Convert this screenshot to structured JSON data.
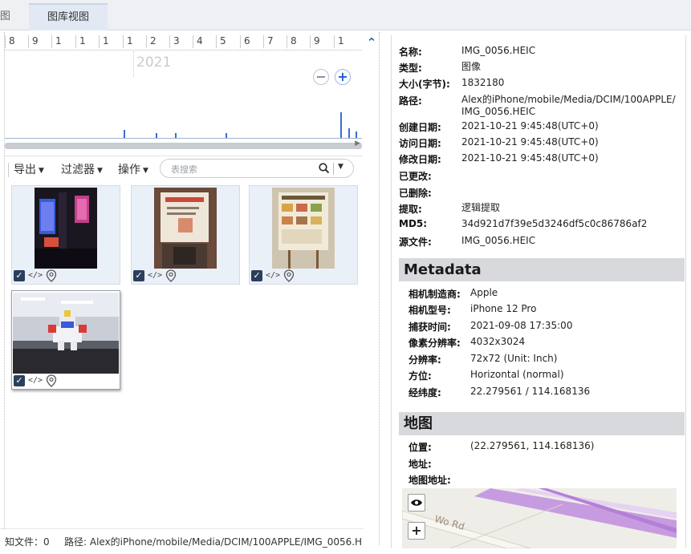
{
  "tabs": {
    "stub": "图",
    "active": "图库视图"
  },
  "timeline": {
    "numbers": [
      "8",
      "9",
      "1",
      "1",
      "1",
      "1",
      "2",
      "3",
      "4",
      "5",
      "6",
      "7",
      "8",
      "9",
      "1"
    ],
    "year": "2021",
    "zoom_out": "−",
    "zoom_in": "+"
  },
  "toolbar": {
    "export": "导出",
    "filter": "过滤器",
    "actions": "操作",
    "search_placeholder": "表搜索"
  },
  "thumbnails": [
    {
      "name": "thumb-1"
    },
    {
      "name": "thumb-2"
    },
    {
      "name": "thumb-3"
    },
    {
      "name": "thumb-4"
    }
  ],
  "status": {
    "unknown_files": "知文件：0",
    "path": "路径: Alex的iPhone/mobile/Media/DCIM/100APPLE/IMG_0056.H"
  },
  "details": {
    "file": [
      {
        "k": "名称:",
        "v": "IMG_0056.HEIC"
      },
      {
        "k": "类型:",
        "v": "图像"
      },
      {
        "k": "大小(字节):",
        "v": "1832180"
      },
      {
        "k": "路径:",
        "v": "Alex的iPhone/mobile/Media/DCIM/100APPLE/",
        "v2": "IMG_0056.HEIC"
      },
      {
        "k": "创建日期:",
        "v": "2021-10-21 9:45:48(UTC+0)"
      },
      {
        "k": "访问日期:",
        "v": "2021-10-21 9:45:48(UTC+0)"
      },
      {
        "k": "修改日期:",
        "v": "2021-10-21 9:45:48(UTC+0)"
      },
      {
        "k": "已更改:",
        "v": ""
      },
      {
        "k": "已删除:",
        "v": ""
      },
      {
        "k": "提取:",
        "v": "逻辑提取"
      },
      {
        "k": "MD5:",
        "v": "34d921d7f39e5d3246df5c0c86786af2"
      },
      {
        "k": "源文件:",
        "v": "IMG_0056.HEIC"
      }
    ],
    "metadata_title": "Metadata",
    "metadata": [
      {
        "k": "相机制造商:",
        "v": "Apple"
      },
      {
        "k": "相机型号:",
        "v": "iPhone 12 Pro"
      },
      {
        "k": "捕获时间:",
        "v": "2021-09-08 17:35:00"
      },
      {
        "k": "像素分辨率:",
        "v": "4032x3024"
      },
      {
        "k": "分辨率:",
        "v": "72x72 (Unit: Inch)"
      },
      {
        "k": "方位:",
        "v": "Horizontal (normal)"
      },
      {
        "k": "经纬度:",
        "v": "22.279561 / 114.168136"
      }
    ],
    "map_title": "地图",
    "map_fields": [
      {
        "k": "位置:",
        "v": "(22.279561, 114.168136)"
      },
      {
        "k": "地址:",
        "v": ""
      },
      {
        "k": "地图地址:",
        "v": ""
      }
    ],
    "map": {
      "road_label": "Wo Rd",
      "zoom_in": "+"
    }
  }
}
